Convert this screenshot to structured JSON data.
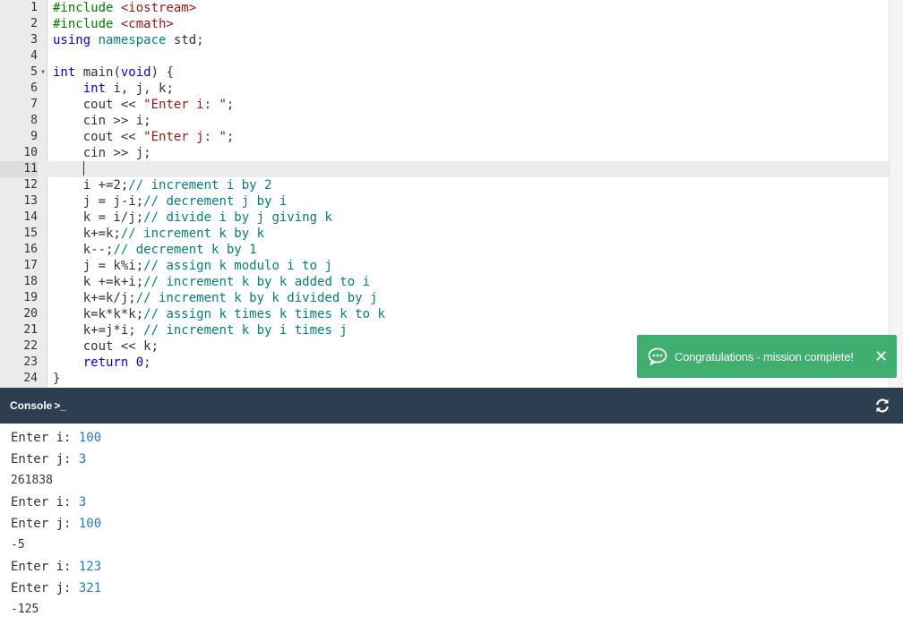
{
  "editor": {
    "active_line": 11,
    "lines": [
      {
        "n": "1",
        "fold": "",
        "tokens": [
          {
            "t": "#include ",
            "c": "inc"
          },
          {
            "t": "<iostream>",
            "c": "str"
          }
        ]
      },
      {
        "n": "2",
        "fold": "",
        "tokens": [
          {
            "t": "#include ",
            "c": "inc"
          },
          {
            "t": "<cmath>",
            "c": "str"
          }
        ]
      },
      {
        "n": "3",
        "fold": "",
        "tokens": [
          {
            "t": "using",
            "c": "kw"
          },
          {
            "t": " namespace ",
            "c": "com"
          },
          {
            "t": "std;",
            "c": ""
          }
        ]
      },
      {
        "n": "4",
        "fold": "",
        "tokens": []
      },
      {
        "n": "5",
        "fold": "▾",
        "tokens": [
          {
            "t": "int",
            "c": "kw"
          },
          {
            "t": " main(",
            "c": ""
          },
          {
            "t": "void",
            "c": "kw"
          },
          {
            "t": ") {",
            "c": ""
          }
        ]
      },
      {
        "n": "6",
        "fold": "",
        "tokens": [
          {
            "t": "    ",
            "c": ""
          },
          {
            "t": "int",
            "c": "kw"
          },
          {
            "t": " i, j, k;",
            "c": ""
          }
        ]
      },
      {
        "n": "7",
        "fold": "",
        "tokens": [
          {
            "t": "    cout << ",
            "c": ""
          },
          {
            "t": "\"Enter i: \"",
            "c": "str"
          },
          {
            "t": ";",
            "c": ""
          }
        ]
      },
      {
        "n": "8",
        "fold": "",
        "tokens": [
          {
            "t": "    cin >> i;",
            "c": ""
          }
        ]
      },
      {
        "n": "9",
        "fold": "",
        "tokens": [
          {
            "t": "    cout << ",
            "c": ""
          },
          {
            "t": "\"Enter j: \"",
            "c": "str"
          },
          {
            "t": ";",
            "c": ""
          }
        ]
      },
      {
        "n": "10",
        "fold": "",
        "tokens": [
          {
            "t": "    cin >> j;",
            "c": ""
          }
        ]
      },
      {
        "n": "11",
        "fold": "",
        "tokens": [
          {
            "t": "    ",
            "c": ""
          },
          {
            "t": "",
            "c": "cursor"
          }
        ]
      },
      {
        "n": "12",
        "fold": "",
        "tokens": [
          {
            "t": "    i +=2;",
            "c": ""
          },
          {
            "t": "// increment i by 2",
            "c": "com"
          }
        ]
      },
      {
        "n": "13",
        "fold": "",
        "tokens": [
          {
            "t": "    j = j-i;",
            "c": ""
          },
          {
            "t": "// decrement j by i",
            "c": "com"
          }
        ]
      },
      {
        "n": "14",
        "fold": "",
        "tokens": [
          {
            "t": "    k = i/j;",
            "c": ""
          },
          {
            "t": "// divide i by j giving k",
            "c": "com"
          }
        ]
      },
      {
        "n": "15",
        "fold": "",
        "tokens": [
          {
            "t": "    k+=k;",
            "c": ""
          },
          {
            "t": "// increment k by k",
            "c": "com"
          }
        ]
      },
      {
        "n": "16",
        "fold": "",
        "tokens": [
          {
            "t": "    k--;",
            "c": ""
          },
          {
            "t": "// decrement k by 1",
            "c": "com"
          }
        ]
      },
      {
        "n": "17",
        "fold": "",
        "tokens": [
          {
            "t": "    j = k%i;",
            "c": ""
          },
          {
            "t": "// assign k modulo i to j",
            "c": "com"
          }
        ]
      },
      {
        "n": "18",
        "fold": "",
        "tokens": [
          {
            "t": "    k +=k+i;",
            "c": ""
          },
          {
            "t": "// increment k by k added to i",
            "c": "com"
          }
        ]
      },
      {
        "n": "19",
        "fold": "",
        "tokens": [
          {
            "t": "    k+=k/j;",
            "c": ""
          },
          {
            "t": "// increment k by k divided by j",
            "c": "com"
          }
        ]
      },
      {
        "n": "20",
        "fold": "",
        "tokens": [
          {
            "t": "    k=k*k*k;",
            "c": ""
          },
          {
            "t": "// assign k times k times k to k",
            "c": "com"
          }
        ]
      },
      {
        "n": "21",
        "fold": "",
        "tokens": [
          {
            "t": "    k+=j*i; ",
            "c": ""
          },
          {
            "t": "// increment k by i times j",
            "c": "com"
          }
        ]
      },
      {
        "n": "22",
        "fold": "",
        "tokens": [
          {
            "t": "    cout << k;",
            "c": ""
          }
        ]
      },
      {
        "n": "23",
        "fold": "",
        "tokens": [
          {
            "t": "    ",
            "c": ""
          },
          {
            "t": "return",
            "c": "kw"
          },
          {
            "t": " ",
            "c": ""
          },
          {
            "t": "0",
            "c": "num"
          },
          {
            "t": ";",
            "c": ""
          }
        ]
      },
      {
        "n": "24",
        "fold": "",
        "tokens": [
          {
            "t": "}",
            "c": ""
          }
        ]
      }
    ]
  },
  "toast": {
    "message": "Congratulations - mission complete!",
    "close_label": "✕",
    "color": "#3fae6e",
    "icon": "chat-bubble-icon"
  },
  "console": {
    "title": "Console",
    "prompt_icon": ">_",
    "header_color": "#2d3e50",
    "refresh_icon": "refresh-icon",
    "lines": [
      {
        "prompt": "Enter i: ",
        "input": "100"
      },
      {
        "prompt": "Enter j: ",
        "input": "3"
      },
      {
        "output": "261838"
      },
      {
        "prompt": "Enter i: ",
        "input": "3"
      },
      {
        "prompt": "Enter j: ",
        "input": "100"
      },
      {
        "output": "-5"
      },
      {
        "prompt": "Enter i: ",
        "input": "123"
      },
      {
        "prompt": "Enter j: ",
        "input": "321"
      },
      {
        "output": "-125"
      }
    ]
  }
}
